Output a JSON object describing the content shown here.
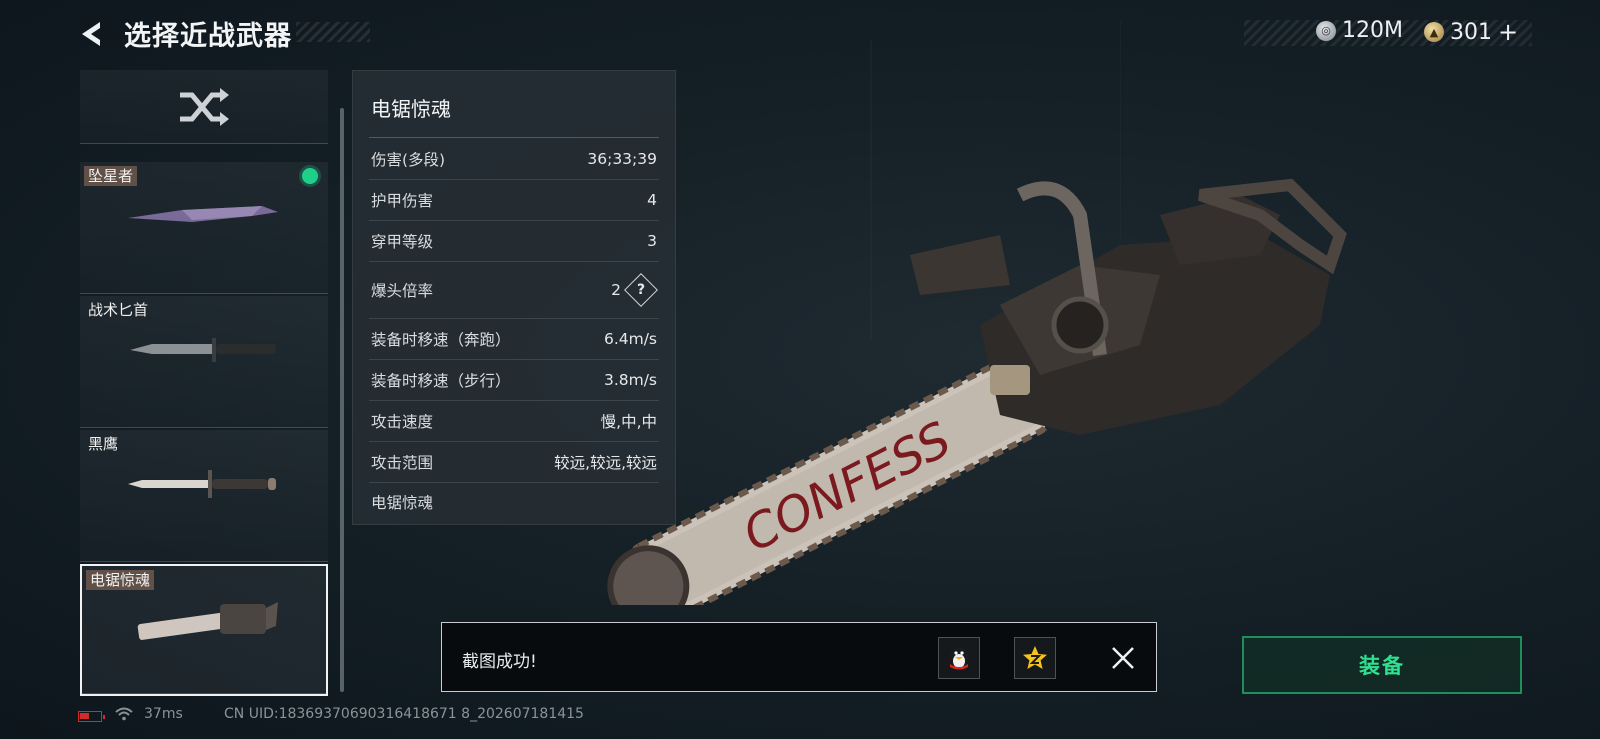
{
  "header": {
    "title": "选择近战武器",
    "currency": [
      {
        "icon": "silver-coin-icon",
        "value": "120M"
      },
      {
        "icon": "gold-coin-icon",
        "value": "301"
      }
    ],
    "add_symbol": "+"
  },
  "weapon_list": {
    "items": [
      {
        "name": "坠星者",
        "equipped": true,
        "selected": false
      },
      {
        "name": "战术匕首",
        "equipped": false,
        "selected": false
      },
      {
        "name": "黑鹰",
        "equipped": false,
        "selected": false
      },
      {
        "name": "电锯惊魂",
        "equipped": false,
        "selected": true
      }
    ]
  },
  "stats_panel": {
    "title": "电锯惊魂",
    "rows": [
      {
        "label": "伤害(多段)",
        "value": "36;33;39"
      },
      {
        "label": "护甲伤害",
        "value": "4"
      },
      {
        "label": "穿甲等级",
        "value": "3"
      },
      {
        "label": "爆头倍率",
        "value": "2",
        "help": "?"
      },
      {
        "label": "装备时移速（奔跑）",
        "value": "6.4m/s"
      },
      {
        "label": "装备时移速（步行）",
        "value": "3.8m/s"
      },
      {
        "label": "攻击速度",
        "value": "慢,中,中"
      },
      {
        "label": "攻击范围",
        "value": "较远,较远,较远"
      }
    ],
    "footer": "电锯惊魂"
  },
  "weapon_art_text": "CONFESS",
  "toast": {
    "message": "截图成功!"
  },
  "equip_button": {
    "label": "装备"
  },
  "status_bar": {
    "ping": "37ms",
    "uid": "CN UID:18369370690316418671 8_202607181415"
  },
  "colors": {
    "accent_green": "#2ee08f",
    "equipped_dot": "#1fd08b",
    "battery_low": "#d02a2a"
  }
}
